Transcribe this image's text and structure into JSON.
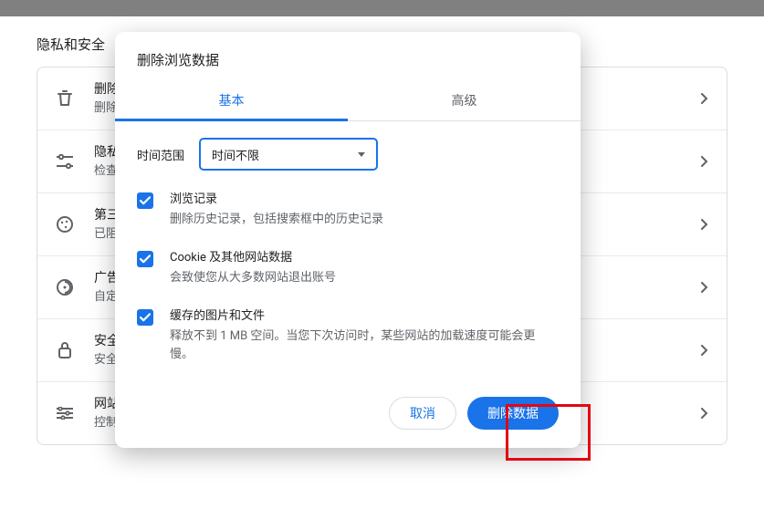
{
  "section_title": "隐私和安全",
  "rows": [
    {
      "title": "删除",
      "subtitle": "删除"
    },
    {
      "title": "隐私",
      "subtitle": "检查"
    },
    {
      "title": "第三",
      "subtitle": "已阻"
    },
    {
      "title": "广告",
      "subtitle": "自定"
    },
    {
      "title": "安全",
      "subtitle": "安全"
    },
    {
      "title": "网站",
      "subtitle": "控制"
    }
  ],
  "modal": {
    "title": "删除浏览数据",
    "tabs": {
      "basic": "基本",
      "advanced": "高级"
    },
    "time_label": "时间范围",
    "time_value": "时间不限",
    "items": [
      {
        "title": "浏览记录",
        "subtitle": "删除历史记录，包括搜索框中的历史记录"
      },
      {
        "title": "Cookie 及其他网站数据",
        "subtitle": "会致使您从大多数网站退出账号"
      },
      {
        "title": "缓存的图片和文件",
        "subtitle": "释放不到 1 MB 空间。当您下次访问时，某些网站的加载速度可能会更慢。"
      }
    ],
    "cancel": "取消",
    "confirm": "删除数据"
  }
}
